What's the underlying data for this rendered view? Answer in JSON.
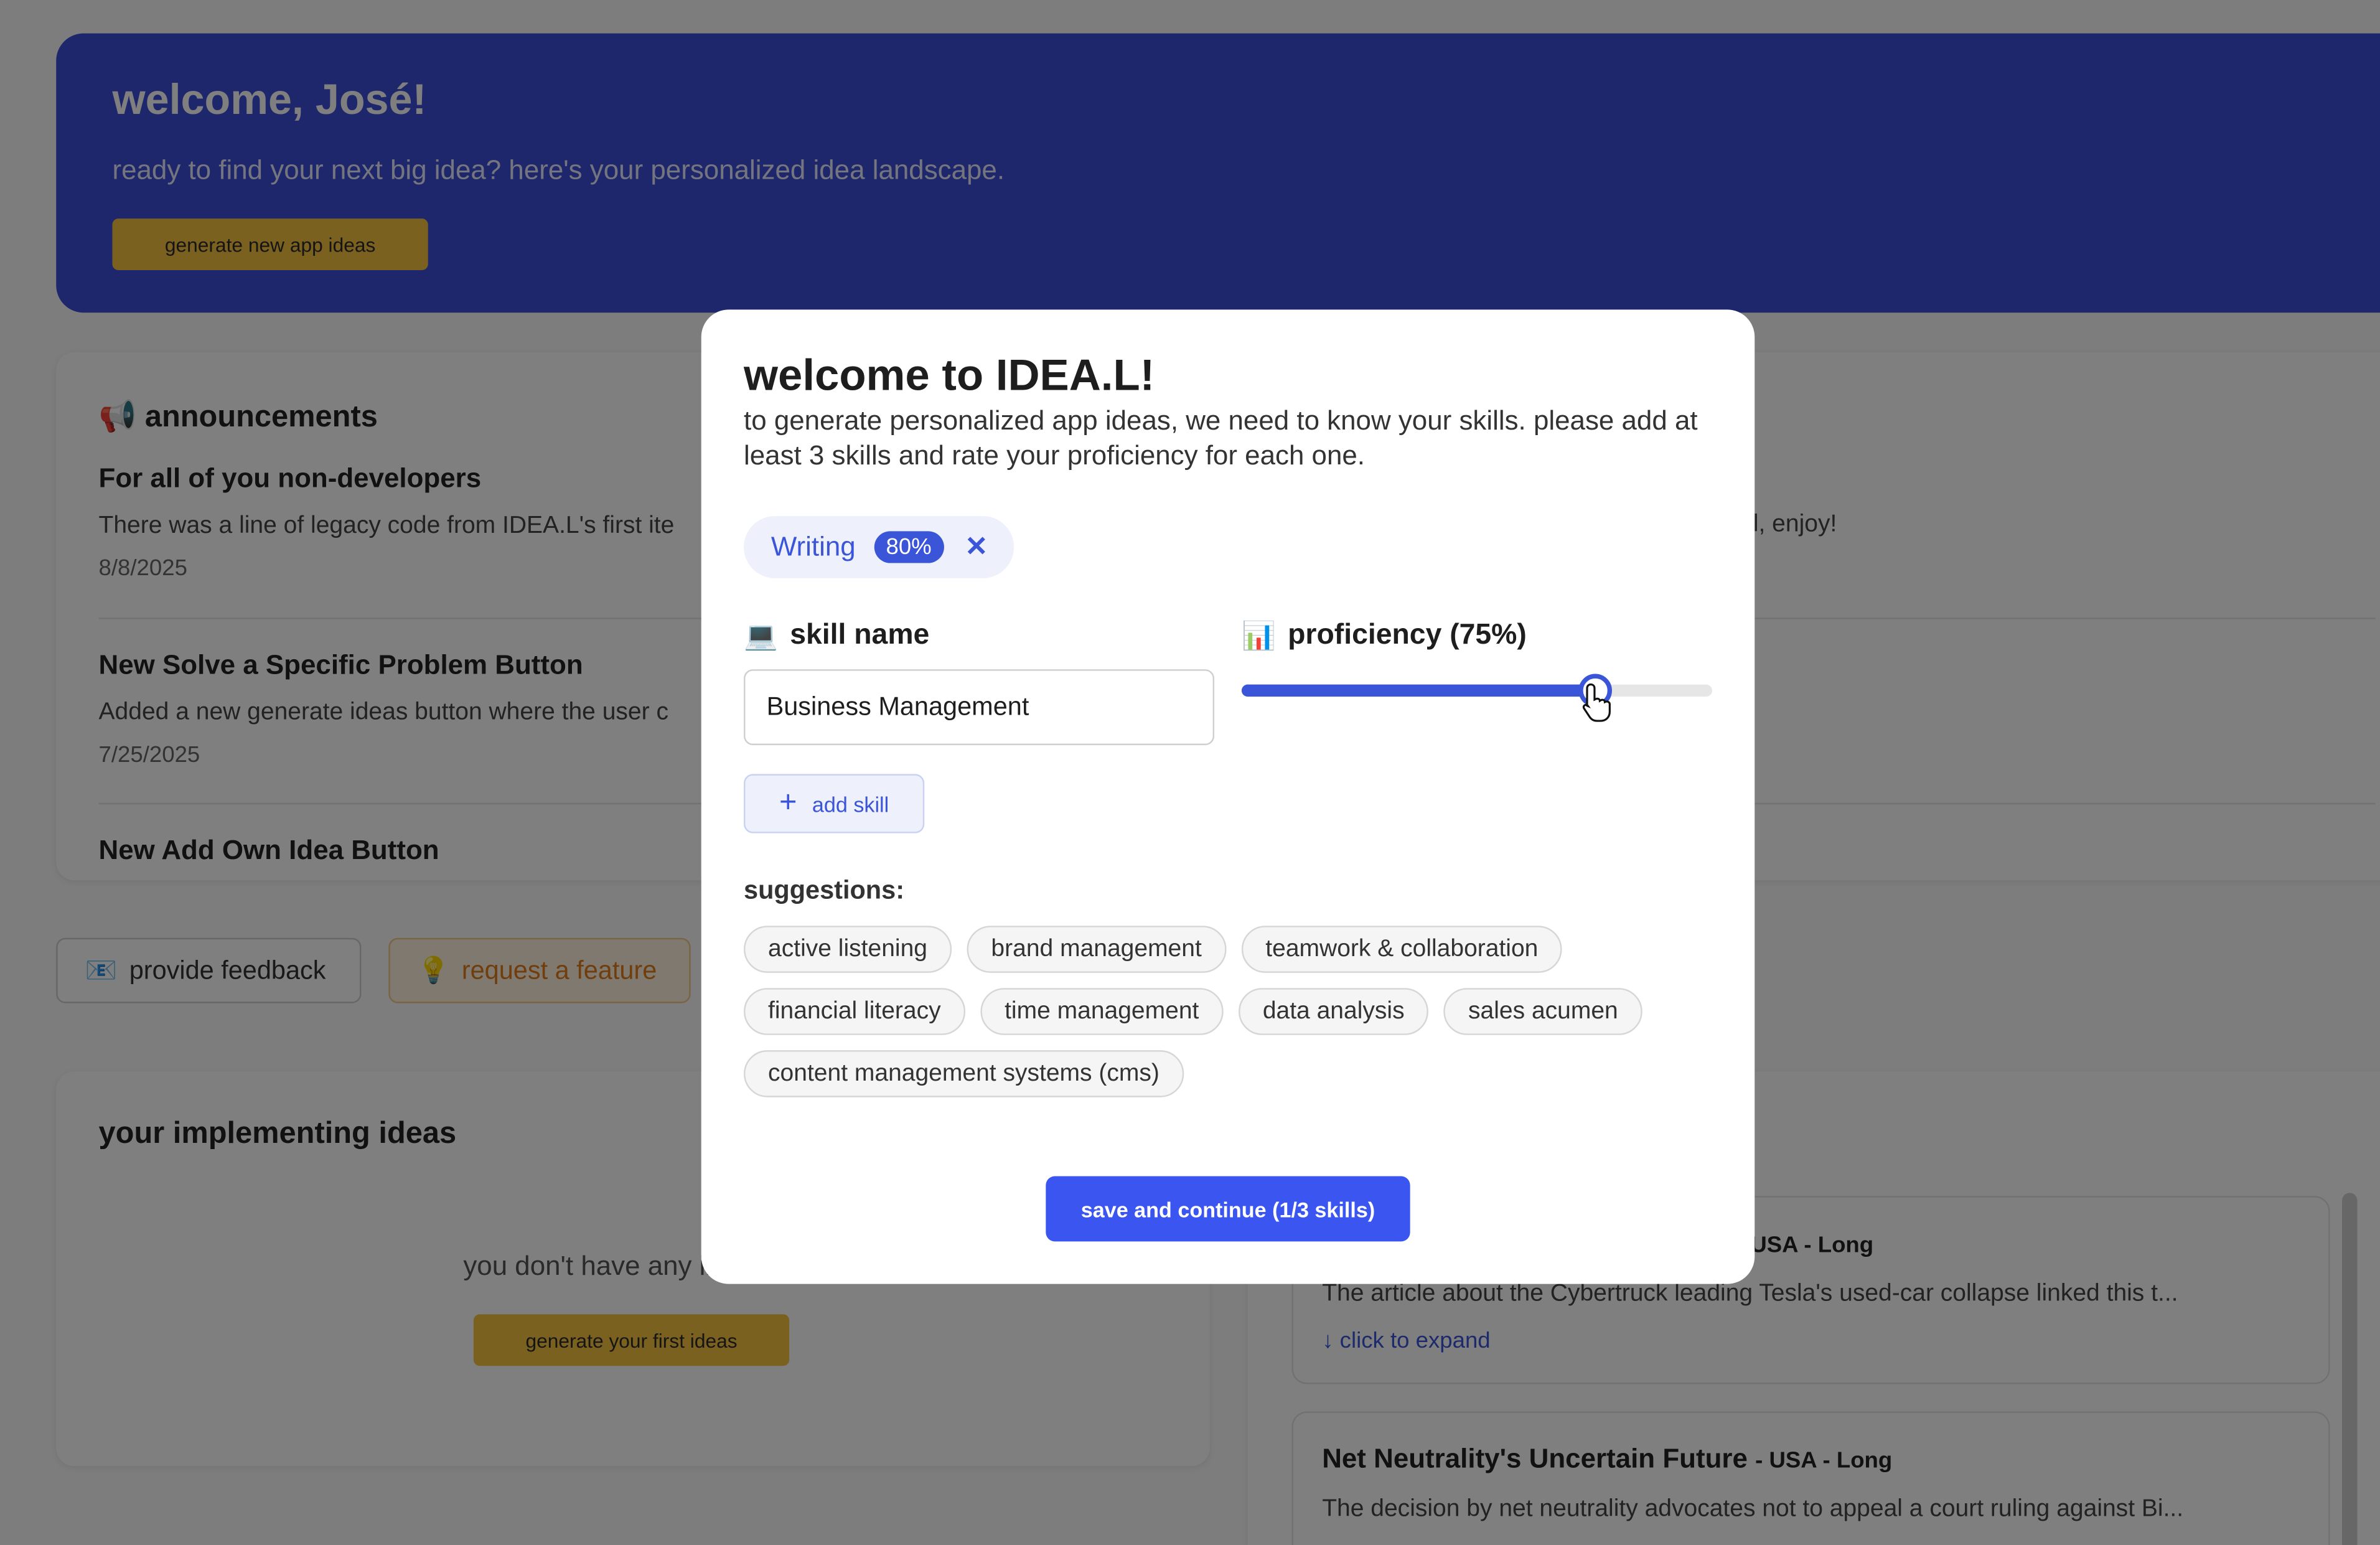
{
  "hero": {
    "title": "welcome, José!",
    "subtitle": "ready to find your next big idea? here's your personalized idea landscape.",
    "button": "generate new app ideas"
  },
  "announcements": {
    "title": "announcements",
    "icon": "megaphone-icon",
    "items": [
      {
        "title": "For all of you non-developers",
        "desc": "There was a line of legacy code from IDEA.L's first ite",
        "desc_right": "l, enjoy!",
        "date": "8/8/2025"
      },
      {
        "title": "New Solve a Specific Problem Button",
        "desc": "Added a new generate ideas button where the user c",
        "date": "7/25/2025"
      },
      {
        "title": "New Add Own Idea Button"
      }
    ]
  },
  "actions": {
    "feedback": "provide feedback",
    "feature": "request a feature"
  },
  "implementing": {
    "title": "your implementing ideas",
    "empty": "you don't have any impleme",
    "button": "generate your first ideas"
  },
  "news": [
    {
      "title": "",
      "meta": "- USA - Long",
      "desc": "The article about the Cybertruck leading Tesla's used-car collapse linked this t...",
      "expand": "↓ click to expand"
    },
    {
      "title": "Net Neutrality's Uncertain Future",
      "meta": "- USA - Long",
      "desc": "The decision by net neutrality advocates not to appeal a court ruling against Bi...",
      "expand": ""
    }
  ],
  "modal": {
    "title": "welcome to IDEA.L!",
    "description": "to generate personalized app ideas, we need to know your skills. please add at least 3 skills and rate your proficiency for each one.",
    "skills": [
      {
        "name": "Writing",
        "proficiency": "80%"
      }
    ],
    "skill_label": "skill name",
    "skill_icon": "laptop-icon",
    "proficiency_label": "proficiency (75%)",
    "proficiency_icon": "bar-chart-icon",
    "proficiency_value": 0.75,
    "skill_input_value": "Business Management",
    "add_button": "add skill",
    "suggestions_title": "suggestions:",
    "suggestions": [
      "active listening",
      "brand management",
      "teamwork & collaboration",
      "financial literacy",
      "time management",
      "data analysis",
      "sales acumen",
      "content management systems (cms)"
    ],
    "save_button": "save and continue (1/3 skills)"
  },
  "colors": {
    "accent": "#3a55d8",
    "hero": "#3c4fd8",
    "cta": "#f6c23e"
  }
}
